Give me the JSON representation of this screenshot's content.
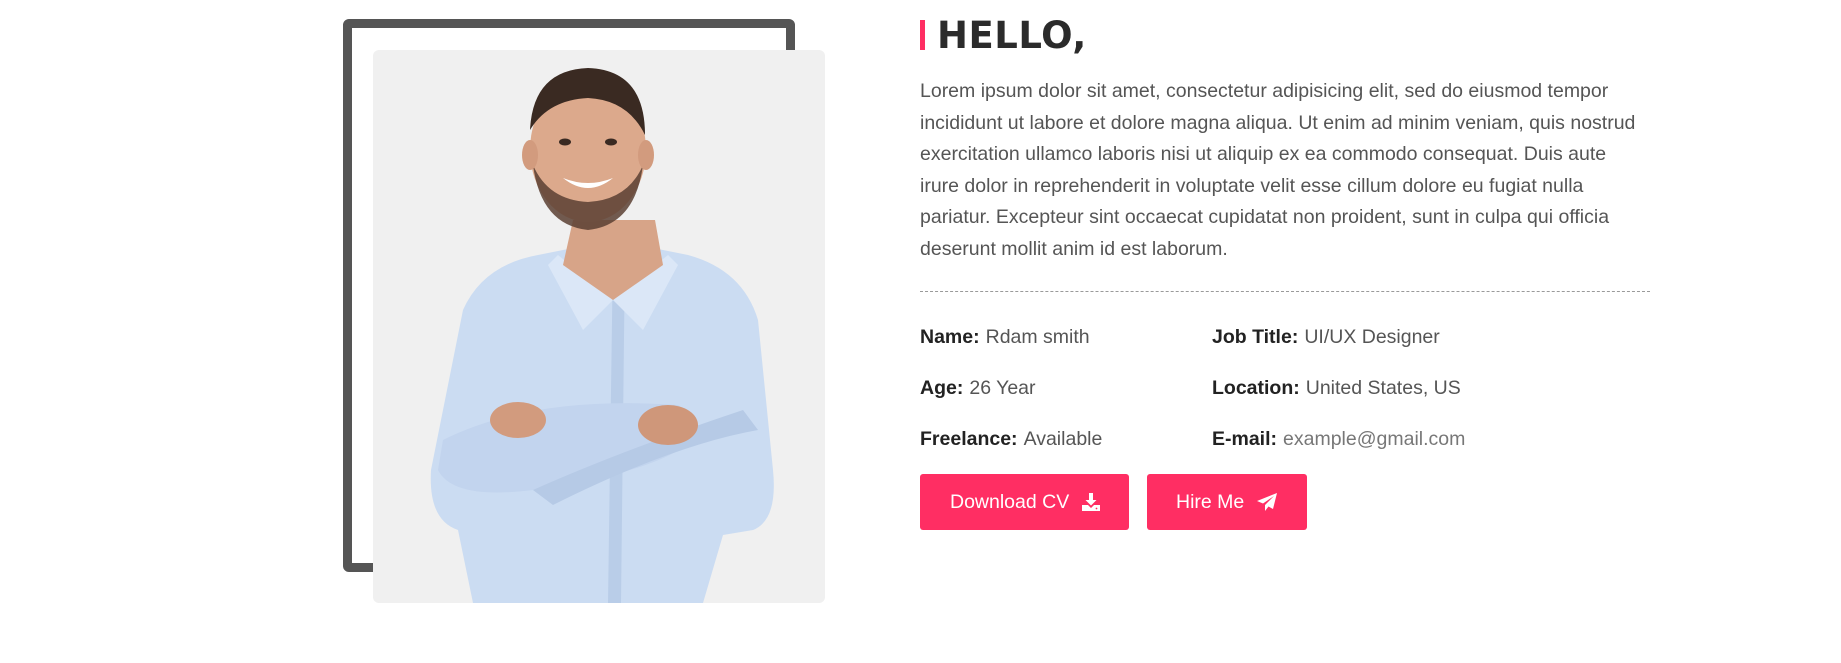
{
  "hero": {
    "heading": "HELLO,",
    "intro": "Lorem ipsum dolor sit amet, consectetur adipisicing elit, sed do eiusmod tempor incididunt ut labore et dolore magna aliqua. Ut enim ad minim veniam, quis nostrud exercitation ullamco laboris nisi ut aliquip ex ea commodo consequat. Duis aute irure dolor in reprehenderit in voluptate velit esse cillum dolore eu fugiat nulla pariatur. Excepteur sint occaecat cupidatat non proident, sunt in culpa qui officia deserunt mollit anim id est laborum.",
    "photo_icon": "profile-photo"
  },
  "info": {
    "name_label": "Name:",
    "name_value": "Rdam smith",
    "job_label": "Job Title:",
    "job_value": "UI/UX Designer",
    "age_label": "Age:",
    "age_value": "26 Year",
    "location_label": "Location:",
    "location_value": "United States, US",
    "freelance_label": "Freelance:",
    "freelance_value": "Available",
    "email_label": "E-mail:",
    "email_value": "example@gmail.com"
  },
  "buttons": {
    "download_label": "Download CV",
    "download_icon": "download-icon",
    "hire_label": "Hire Me",
    "hire_icon": "paper-plane-icon"
  },
  "colors": {
    "accent": "#ff2e63",
    "frame": "#555555",
    "photo_bg": "#f0f0f0",
    "heading": "#2b2b2b",
    "text": "#555555"
  }
}
